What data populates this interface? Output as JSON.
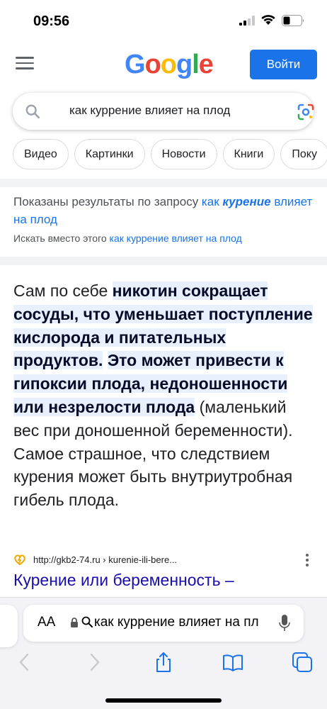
{
  "status_bar": {
    "time": "09:56"
  },
  "header": {
    "logo": "Google",
    "login_label": "Войти"
  },
  "search": {
    "query": "как куррение влияет на плод"
  },
  "chips": [
    "Видео",
    "Картинки",
    "Новости",
    "Книги",
    "Поку"
  ],
  "correction": {
    "shown_prefix": "Показаны результаты по запросу ",
    "shown_q1": "как ",
    "shown_q2": "курение",
    "shown_q3": " влияет на плод",
    "instead_prefix": "Искать вместо этого ",
    "instead_link": "как куррение влияет на плод"
  },
  "snippet": {
    "p1": "Сам по себе ",
    "h1": "никотин сокращает сосуды, что уменьшает поступление кислорода и питательных продуктов.",
    "p2": " ",
    "h2": "Это может привести к гипоксии плода, недоношенности или незрелости плода",
    "p3": " (маленький вес при доношенной беременности). Самое страшное, что следствием курения может быть внутриутробная гибель плода."
  },
  "source": {
    "url": "http://gkb2-74.ru › kurenie-ili-bere...",
    "title": "Курение или беременность –"
  },
  "safari": {
    "aa_label": "AA",
    "address_text": "как куррение влияет на пл"
  },
  "colors": {
    "accent_blue": "#1a73e8",
    "highlight": "#e8f0fe",
    "link": "#1a0dab"
  }
}
